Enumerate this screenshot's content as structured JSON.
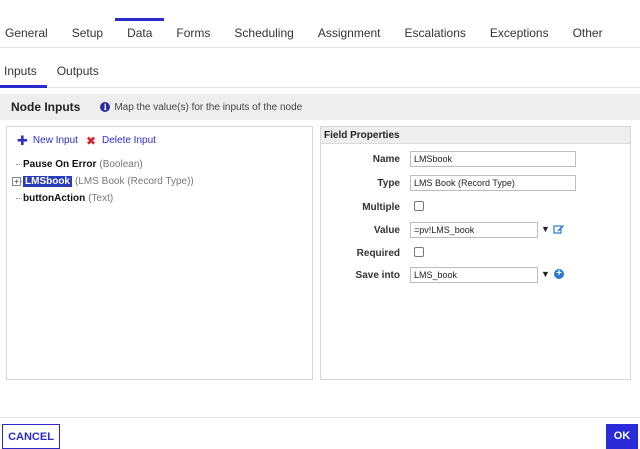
{
  "tabs": [
    "General",
    "Setup",
    "Data",
    "Forms",
    "Scheduling",
    "Assignment",
    "Escalations",
    "Exceptions",
    "Other"
  ],
  "active_tab": "Data",
  "subtabs": [
    "Inputs",
    "Outputs"
  ],
  "active_subtab": "Inputs",
  "node_inputs": {
    "title": "Node Inputs",
    "info_text": "Map the value(s) for the inputs of the node"
  },
  "toolbar": {
    "new_input": "New Input",
    "delete_input": "Delete Input"
  },
  "tree": [
    {
      "name": "Pause On Error",
      "type": "(Boolean)",
      "selected": false,
      "expandable": false
    },
    {
      "name": "LMSbook",
      "type": "(LMS Book (Record Type))",
      "selected": true,
      "expandable": true
    },
    {
      "name": "buttonAction",
      "type": "(Text)",
      "selected": false,
      "expandable": false
    }
  ],
  "field_properties": {
    "header": "Field Properties",
    "name_label": "Name",
    "name_value": "LMSbook",
    "type_label": "Type",
    "type_value": "LMS Book (Record Type)",
    "multiple_label": "Multiple",
    "multiple_checked": false,
    "value_label": "Value",
    "value_value": "=pv!LMS_book",
    "required_label": "Required",
    "required_checked": false,
    "save_into_label": "Save into",
    "save_into_value": "LMS_book"
  },
  "footer": {
    "cancel": "CANCEL",
    "ok": "OK"
  },
  "colors": {
    "accent": "#2b2bc9",
    "delete_red": "#d9242c",
    "selected_bg": "#2b3bb8"
  },
  "icons": {
    "info": "info-icon",
    "new": "plus-icon",
    "delete": "x-icon",
    "expander": "expand-plus-icon",
    "edit": "edit-icon",
    "add": "add-circle-icon",
    "caret": "caret-down-icon"
  }
}
